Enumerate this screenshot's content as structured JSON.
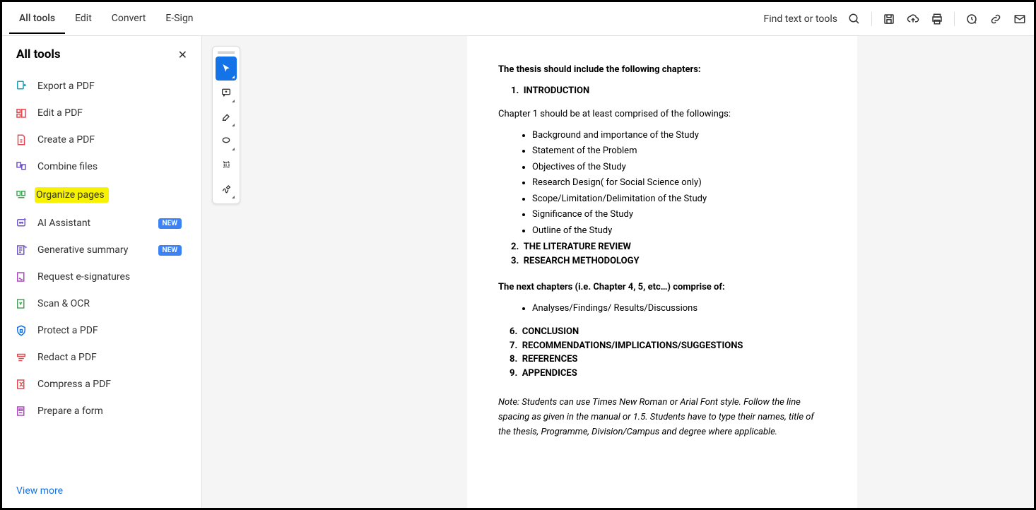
{
  "topbar": {
    "tabs": [
      "All tools",
      "Edit",
      "Convert",
      "E-Sign"
    ],
    "find_label": "Find text or tools"
  },
  "sidebar": {
    "title": "All tools",
    "items": [
      {
        "label": "Export a PDF"
      },
      {
        "label": "Edit a PDF"
      },
      {
        "label": "Create a PDF"
      },
      {
        "label": "Combine files"
      },
      {
        "label": "Organize pages",
        "highlight": true
      },
      {
        "label": "AI Assistant",
        "new": true
      },
      {
        "label": "Generative summary",
        "new": true
      },
      {
        "label": "Request e-signatures"
      },
      {
        "label": "Scan & OCR"
      },
      {
        "label": "Protect a PDF"
      },
      {
        "label": "Redact a PDF"
      },
      {
        "label": "Compress a PDF"
      },
      {
        "label": "Prepare a form"
      }
    ],
    "view_more": "View more",
    "new_badge": "NEW"
  },
  "doc": {
    "heading1": "The thesis should include the following chapters:",
    "ch1_num": "1.",
    "ch1": "INTRODUCTION",
    "ch1_intro": "Chapter 1 should be at least comprised of the followings:",
    "ch1_items": [
      "Background and importance of the Study",
      "Statement of the Problem",
      "Objectives of the Study",
      "Research Design( for Social Science only)",
      "Scope/Limitation/Delimitation of the Study",
      "Significance of the Study",
      "Outline of the Study"
    ],
    "ch2_num": "2.",
    "ch2": "THE LITERATURE REVIEW",
    "ch3_num": "3.",
    "ch3": "RESEARCH METHODOLOGY",
    "heading2": "The next chapters (i.e. Chapter 4, 5, etc…) comprise of:",
    "next_item": "Analyses/Findings/ Results/Discussions",
    "ch6_num": "6.",
    "ch6": "CONCLUSION",
    "ch7_num": "7.",
    "ch7": "RECOMMENDATIONS/IMPLICATIONS/SUGGESTIONS",
    "ch8_num": "8.",
    "ch8": "REFERENCES",
    "ch9_num": "9.",
    "ch9": "APPENDICES",
    "note": "Note: Students can use Times New Roman or Arial Font style. Follow the line spacing as given in the manual or 1.5. Students have to type their names, title of the thesis, Programme, Division/Campus and degree where applicable."
  }
}
